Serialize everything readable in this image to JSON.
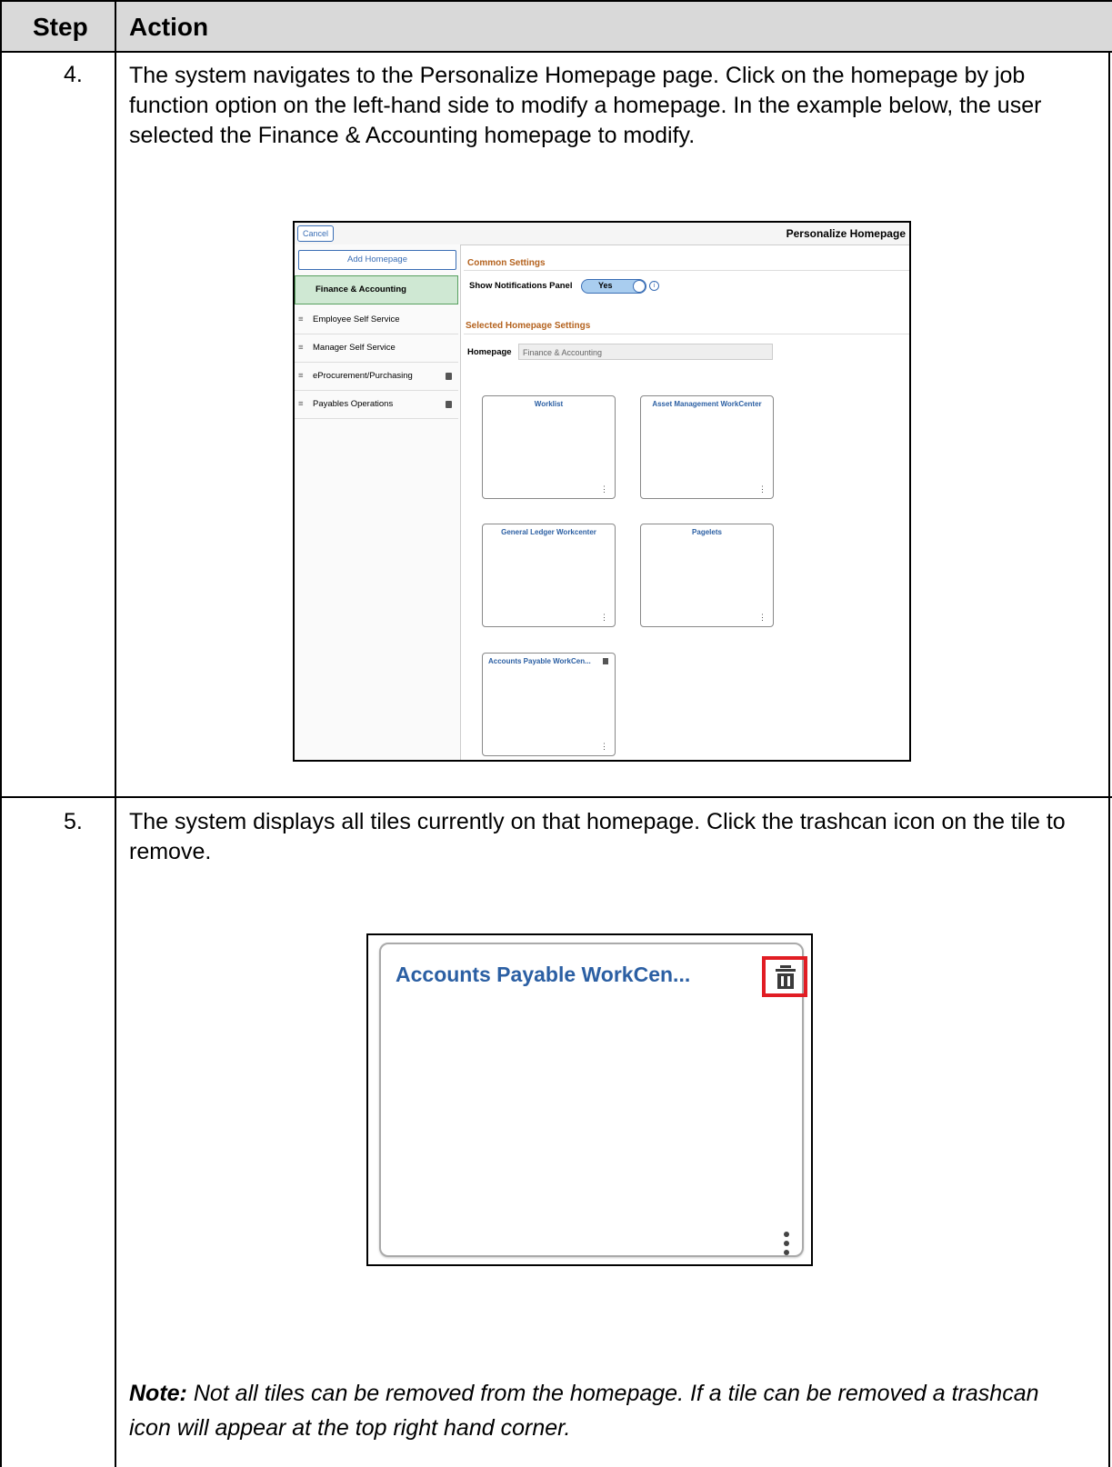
{
  "table": {
    "header_step": "Step",
    "header_action": "Action"
  },
  "rows": [
    {
      "step": "4.",
      "text": "The system navigates to the Personalize Homepage page. Click on the homepage by job function option on the left-hand side to modify a homepage. In the example below, the user selected the Finance & Accounting homepage to modify."
    },
    {
      "step": "5.",
      "text": "The system displays all tiles currently on that homepage. Click the trashcan icon on the tile to remove.",
      "note_label": "Note:",
      "note_text": " Not all tiles can be removed from the homepage. If a tile can be removed a trashcan icon will appear at the top right hand corner."
    }
  ],
  "screenshot1": {
    "cancel": "Cancel",
    "title": "Personalize Homepage",
    "add_homepage": "Add Homepage",
    "selected": "Finance & Accounting",
    "sidebar_items": [
      "Employee Self Service",
      "Manager Self Service",
      "eProcurement/Purchasing",
      "Payables Operations"
    ],
    "common_settings": "Common Settings",
    "show_notifications": "Show Notifications Panel",
    "toggle_value": "Yes",
    "selected_settings": "Selected Homepage Settings",
    "homepage_label": "Homepage",
    "homepage_value": "Finance & Accounting",
    "tiles": [
      "Worklist",
      "Asset Management WorkCenter",
      "General Ledger Workcenter",
      "Pagelets",
      "Accounts Payable WorkCen..."
    ]
  },
  "screenshot2": {
    "tile_title": "Accounts Payable WorkCen..."
  },
  "colors": {
    "header_bg": "#d9d9d9",
    "tile_title": "#2b5fa3",
    "highlight": "#e11d24",
    "section_heading": "#b4621e",
    "selected_item": "#cfe8d3"
  }
}
